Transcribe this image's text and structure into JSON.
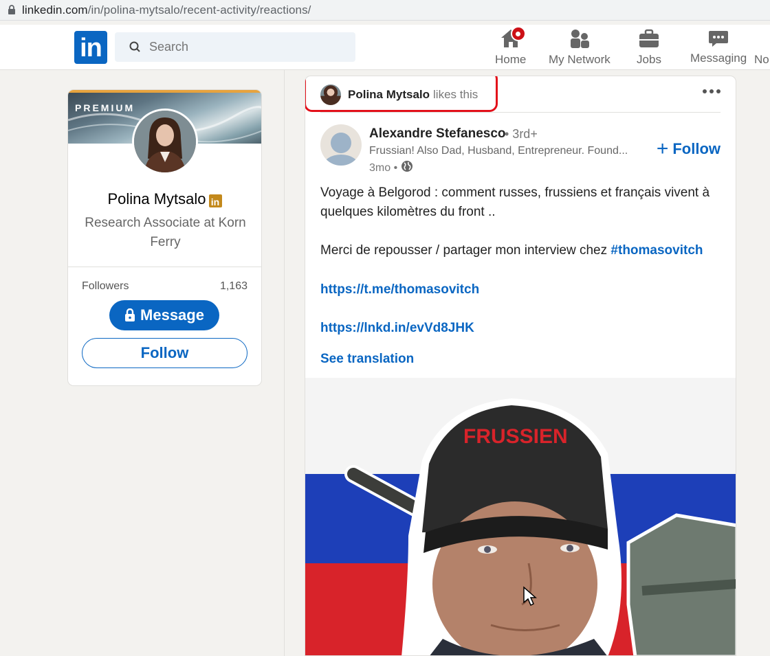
{
  "browser": {
    "url_host": "linkedin.com",
    "url_path": "/in/polina-mytsalo/recent-activity/reactions/"
  },
  "nav": {
    "logo": "in",
    "search_placeholder": "Search",
    "items": [
      {
        "label": "Home",
        "icon": "home-icon",
        "has_notification": true
      },
      {
        "label": "My Network",
        "icon": "people-icon"
      },
      {
        "label": "Jobs",
        "icon": "briefcase-icon"
      },
      {
        "label": "Messaging",
        "icon": "chat-icon"
      },
      {
        "label": "No",
        "icon": "bell-icon"
      }
    ]
  },
  "profile": {
    "banner_label": "PREMIUM",
    "name": "Polina Mytsalo",
    "premium_badge": "in",
    "headline": "Research Associate at Korn Ferry",
    "followers_label": "Followers",
    "followers_count": "1,163",
    "message_button": "Message",
    "follow_button": "Follow"
  },
  "post": {
    "liker_name": "Polina Mytsalo",
    "liker_action": "likes this",
    "author_name": "Alexandre Stefanesco",
    "author_degree": "• 3rd+",
    "author_headline": "Frussian! Also Dad, Husband, Entrepreneur. Found...",
    "time": "3mo •",
    "follow_label": "Follow",
    "text_line1": "Voyage à Belgorod : comment russes, frussiens et français vivent à quelques kilomètres du front ..",
    "text_line2_prefix": "Merci de repousser / partager mon interview chez ",
    "hashtag": "#thomasovitch",
    "link1": "https://t.me/thomasovitch",
    "link2": "https://lnkd.in/evVd8JHK",
    "see_translation": "See translation",
    "image_hat_text": "FRUSSIEN"
  },
  "colors": {
    "brand": "#0a66c2",
    "highlight_box": "#e3101a",
    "premium_gold": "#c3891c",
    "notification": "#cc1016"
  }
}
